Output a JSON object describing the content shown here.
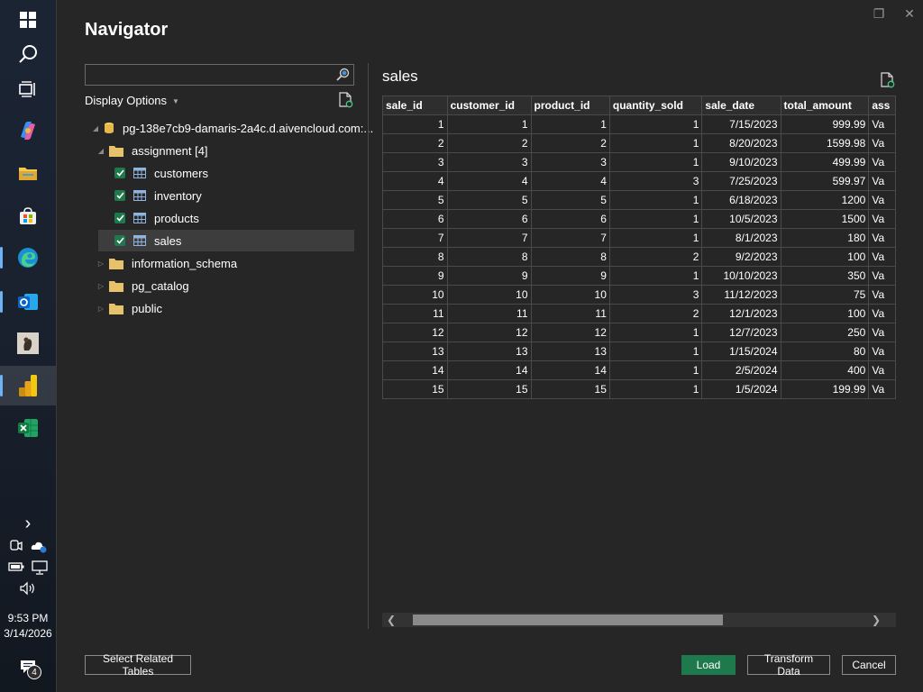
{
  "dialog": {
    "title": "Navigator"
  },
  "window_controls": {
    "restore": "❐",
    "close": "✕"
  },
  "left_pane": {
    "search": {
      "value": "",
      "placeholder": ""
    },
    "display_options": "Display Options",
    "tree": {
      "root": "pg-138e7cb9-damaris-2a4c.d.aivencloud.com:...",
      "folder": "assignment [4]",
      "tables": [
        {
          "label": "customers",
          "checked": true
        },
        {
          "label": "inventory",
          "checked": true
        },
        {
          "label": "products",
          "checked": true
        },
        {
          "label": "sales",
          "checked": true,
          "selected": true
        }
      ],
      "other_folders": [
        "information_schema",
        "pg_catalog",
        "public"
      ]
    }
  },
  "preview": {
    "title": "sales",
    "columns": [
      "sale_id",
      "customer_id",
      "product_id",
      "quantity_sold",
      "sale_date",
      "total_amount",
      "ass"
    ],
    "rows": [
      [
        "1",
        "1",
        "1",
        "1",
        "7/15/2023",
        "999.99",
        "Va"
      ],
      [
        "2",
        "2",
        "2",
        "1",
        "8/20/2023",
        "1599.98",
        "Va"
      ],
      [
        "3",
        "3",
        "3",
        "1",
        "9/10/2023",
        "499.99",
        "Va"
      ],
      [
        "4",
        "4",
        "4",
        "3",
        "7/25/2023",
        "599.97",
        "Va"
      ],
      [
        "5",
        "5",
        "5",
        "1",
        "6/18/2023",
        "1200",
        "Va"
      ],
      [
        "6",
        "6",
        "6",
        "1",
        "10/5/2023",
        "1500",
        "Va"
      ],
      [
        "7",
        "7",
        "7",
        "1",
        "8/1/2023",
        "180",
        "Va"
      ],
      [
        "8",
        "8",
        "8",
        "2",
        "9/2/2023",
        "100",
        "Va"
      ],
      [
        "9",
        "9",
        "9",
        "1",
        "10/10/2023",
        "350",
        "Va"
      ],
      [
        "10",
        "10",
        "10",
        "3",
        "11/12/2023",
        "75",
        "Va"
      ],
      [
        "11",
        "11",
        "11",
        "2",
        "12/1/2023",
        "100",
        "Va"
      ],
      [
        "12",
        "12",
        "12",
        "1",
        "12/7/2023",
        "250",
        "Va"
      ],
      [
        "13",
        "13",
        "13",
        "1",
        "1/15/2024",
        "80",
        "Va"
      ],
      [
        "14",
        "14",
        "14",
        "1",
        "2/5/2024",
        "400",
        "Va"
      ],
      [
        "15",
        "15",
        "15",
        "1",
        "1/5/2024",
        "199.99",
        "Va"
      ]
    ],
    "scroll_arrows": {
      "left": "❮",
      "right": "❯"
    }
  },
  "buttons": {
    "select_related": "Select Related Tables",
    "load": "Load",
    "transform": "Transform Data",
    "cancel": "Cancel"
  },
  "taskbar": {
    "icons": [
      "windows-icon",
      "search-icon",
      "task-view-icon",
      "copilot-icon",
      "file-explorer-icon",
      "store-icon",
      "edge-icon",
      "outlook-icon",
      "photos-icon",
      "power-bi-icon",
      "excel-icon"
    ],
    "time": "9:53 PM",
    "date": "3/14/2026",
    "notification_count": "4",
    "chevron": "›"
  },
  "colors": {
    "accent": "#1e7a4c",
    "background": "#262626",
    "selection": "#3d3d3d"
  }
}
